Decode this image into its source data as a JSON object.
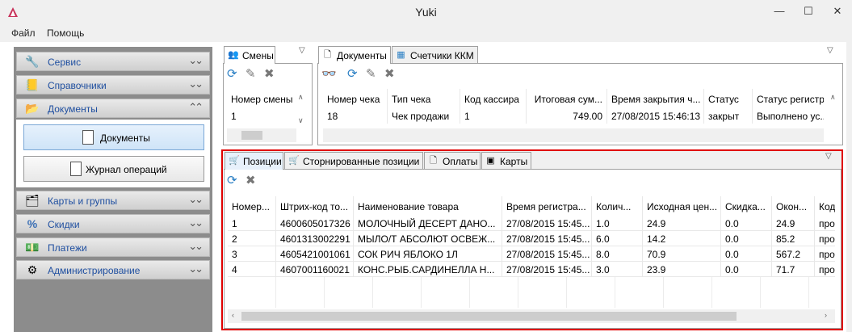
{
  "window": {
    "title": "Yuki",
    "minimize": "—",
    "maximize": "☐",
    "close": "✕"
  },
  "menubar": {
    "items": [
      {
        "label": "Файл"
      },
      {
        "label": "Помощь"
      }
    ]
  },
  "sidebar": {
    "groups": [
      {
        "label": "Сервис",
        "icon": "wrench-icon"
      },
      {
        "label": "Справочники",
        "icon": "book-icon"
      },
      {
        "label": "Документы",
        "icon": "documents-icon"
      },
      {
        "label": "Карты и группы",
        "icon": "cards-icon"
      },
      {
        "label": "Скидки",
        "icon": "percent-icon"
      },
      {
        "label": "Платежи",
        "icon": "money-icon"
      },
      {
        "label": "Администрирование",
        "icon": "gears-icon"
      }
    ],
    "documents_subitems": [
      {
        "label": "Документы"
      },
      {
        "label": "Журнал операций"
      }
    ]
  },
  "shifts": {
    "tab": "Смены",
    "columns": [
      "Номер смены"
    ],
    "rows": [
      [
        "1"
      ]
    ]
  },
  "documents": {
    "tabs": [
      {
        "label": "Документы"
      },
      {
        "label": "Счетчики ККМ"
      }
    ],
    "columns": [
      "Номер чека",
      "Тип чека",
      "Код кассира",
      "Итоговая сум...",
      "Время закрытия ч...",
      "Статус",
      "Статус регистр..."
    ],
    "rows": [
      [
        "18",
        "Чек продажи",
        "1",
        "749.00",
        "27/08/2015 15:46:13",
        "закрыт",
        "Выполнено ус..."
      ]
    ],
    "partial_row": [
      "",
      "",
      "",
      "",
      "",
      "",
      ""
    ]
  },
  "positions": {
    "tabs": [
      {
        "label": "Позиции"
      },
      {
        "label": "Сторнированные позиции"
      },
      {
        "label": "Оплаты"
      },
      {
        "label": "Карты"
      }
    ],
    "columns": [
      "Номер...",
      "Штрих-код то...",
      "Наименование товара",
      "Время регистра...",
      "Колич...",
      "Исходная цен...",
      "Скидка...",
      "Окон...",
      "Код"
    ],
    "rows": [
      [
        "1",
        "4600605017326",
        "МОЛОЧНЫЙ ДЕСЕРТ ДАНО...",
        "27/08/2015 15:45...",
        "1.0",
        "24.9",
        "0.0",
        "24.9",
        "про"
      ],
      [
        "2",
        "4601313002291",
        "МЫЛО/Т АБСОЛЮТ ОСВЕЖ...",
        "27/08/2015 15:45...",
        "6.0",
        "14.2",
        "0.0",
        "85.2",
        "про"
      ],
      [
        "3",
        "4605421001061",
        "СОК РИЧ ЯБЛОКО 1Л",
        "27/08/2015 15:45...",
        "8.0",
        "70.9",
        "0.0",
        "567.2",
        "про"
      ],
      [
        "4",
        "4607001160021",
        "КОНС.РЫБ.САРДИНЕЛЛА Н...",
        "27/08/2015 15:45...",
        "3.0",
        "23.9",
        "0.0",
        "71.7",
        "про"
      ]
    ]
  },
  "colors": {
    "highlight": "#e00000",
    "nav_text": "#1f4fa0",
    "accent": "#2a7fc4"
  }
}
